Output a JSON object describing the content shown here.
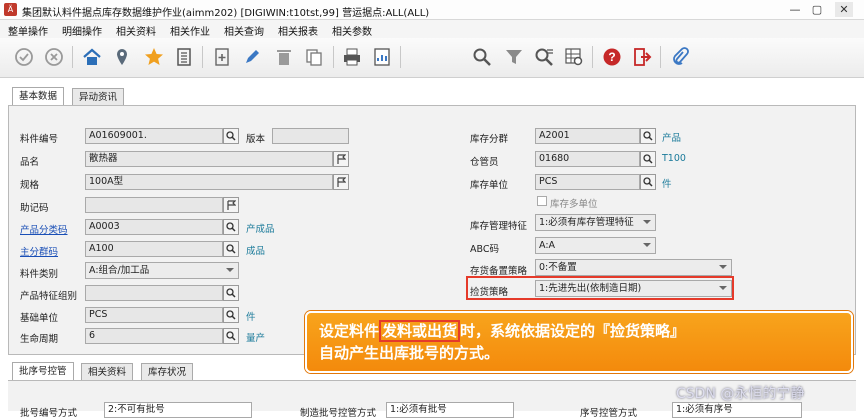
{
  "window": {
    "title": "集团默认料件据点库存数据维护作业(aimm202)    [DIGIWIN:t10tst,99]    营运据点:ALL(ALL)",
    "app_icon": "Ä",
    "min": "—",
    "max": "▢",
    "close": "✕"
  },
  "menu": [
    "整单操作",
    "明细操作",
    "相关资料",
    "相关作业",
    "相关查询",
    "相关报表",
    "相关参数"
  ],
  "tabs": {
    "top": [
      "基本数据",
      "异动资讯"
    ],
    "bottom": [
      "批序号控管",
      "相关资料",
      "库存状况"
    ]
  },
  "left": {
    "item_no": {
      "label": "料件编号",
      "value": "A01609001."
    },
    "version": {
      "label": "版本",
      "value": ""
    },
    "name": {
      "label": "品名",
      "value": "散热器"
    },
    "spec": {
      "label": "规格",
      "value": "100A型"
    },
    "mnemonic": {
      "label": "助记码",
      "value": ""
    },
    "product_class": {
      "label": "产品分类码",
      "value": "A0003",
      "desc": "产成品"
    },
    "main_class": {
      "label": "主分群码",
      "value": "A100",
      "desc": "成品"
    },
    "item_type": {
      "label": "料件类别",
      "value": "A:组合/加工品"
    },
    "feature_group": {
      "label": "产品特征组别",
      "value": ""
    },
    "base_unit": {
      "label": "基础单位",
      "value": "PCS",
      "desc": "件"
    },
    "lifecycle": {
      "label": "生命周期",
      "value": "6",
      "desc": "量产"
    }
  },
  "right": {
    "inv_group": {
      "label": "库存分群",
      "value": "A2001",
      "desc": "产品"
    },
    "keeper": {
      "label": "仓管员",
      "value": "01680",
      "desc": "T100"
    },
    "inv_unit": {
      "label": "库存单位",
      "value": "PCS",
      "desc": "件"
    },
    "multi_unit": {
      "label": "库存多单位",
      "checked": false
    },
    "feature_mgmt": {
      "label": "库存管理特征",
      "value": "1:必须有库存管理特征"
    },
    "abc": {
      "label": "ABC码",
      "value": "A:A"
    },
    "stock_policy": {
      "label": "存货备置策略",
      "value": "0:不备置"
    },
    "pick_policy": {
      "label": "捡货策略",
      "value": "1:先进先出(依制造日期)"
    }
  },
  "callout": {
    "pre": "设定料件",
    "hl": "发料或出货",
    "post": "时，系统依据设定的『捡货策略』",
    "line2": "自动产生出库批号的方式。"
  },
  "lower": {
    "f1_label": "批号编号方式",
    "f1_value": "2:不可有批号",
    "f2_label": "制造批号控管方式",
    "f2_value": "1:必须有批号",
    "f3_label": "序号控管方式",
    "f3_value": "1:必须有序号"
  },
  "watermark": "CSDN @永恒的宁静"
}
